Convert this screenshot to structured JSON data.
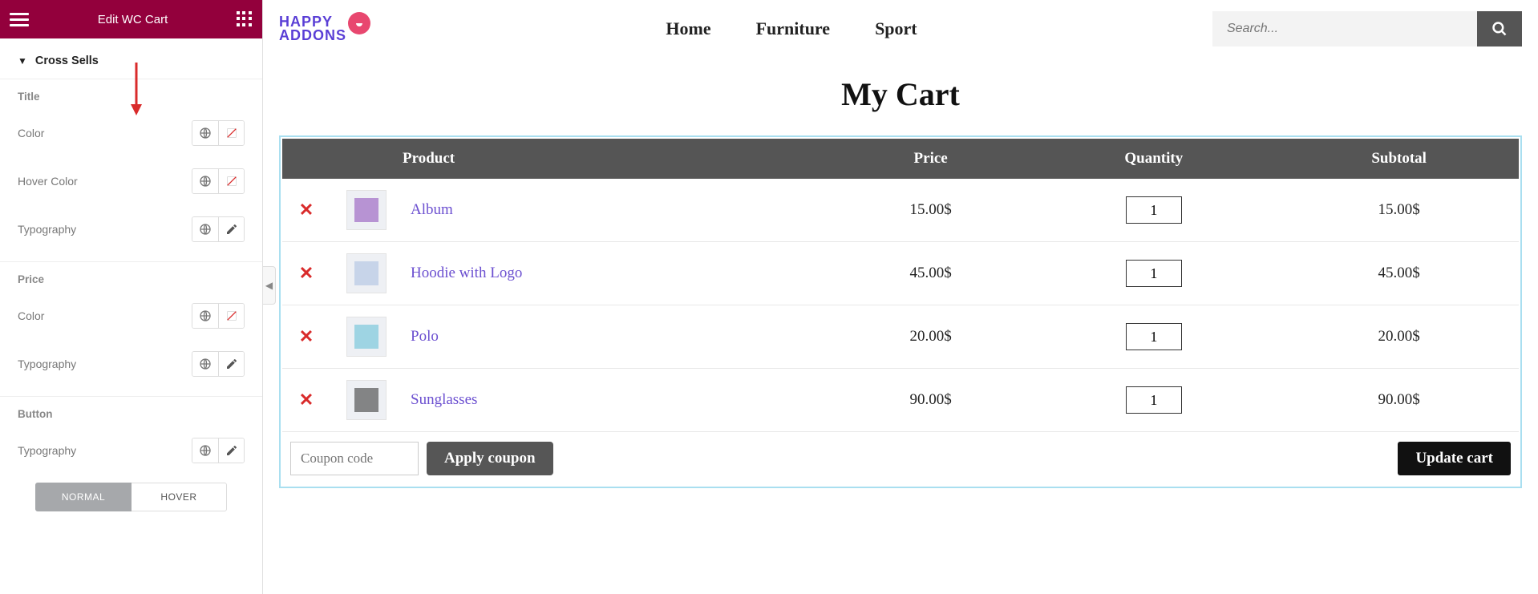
{
  "sidebar": {
    "header_title": "Edit WC Cart",
    "section_label": "Cross Sells",
    "groups": [
      {
        "title": "Title",
        "controls": [
          {
            "label": "Color",
            "type": "color"
          },
          {
            "label": "Hover Color",
            "type": "color"
          },
          {
            "label": "Typography",
            "type": "typography"
          }
        ]
      },
      {
        "title": "Price",
        "controls": [
          {
            "label": "Color",
            "type": "color"
          },
          {
            "label": "Typography",
            "type": "typography"
          }
        ]
      },
      {
        "title": "Button",
        "controls": [
          {
            "label": "Typography",
            "type": "typography"
          }
        ]
      }
    ],
    "state_tabs": {
      "normal": "NORMAL",
      "hover": "HOVER"
    }
  },
  "main": {
    "logo": {
      "line1": "HAPPY",
      "line2": "ADDONS"
    },
    "nav": [
      "Home",
      "Furniture",
      "Sport"
    ],
    "search_placeholder": "Search...",
    "page_title": "My Cart",
    "table": {
      "headers": {
        "product": "Product",
        "price": "Price",
        "quantity": "Quantity",
        "subtotal": "Subtotal"
      },
      "rows": [
        {
          "name": "Album",
          "price": "15.00$",
          "qty": "1",
          "subtotal": "15.00$",
          "thumb_color": "#a06bc4"
        },
        {
          "name": "Hoodie with Logo",
          "price": "45.00$",
          "qty": "1",
          "subtotal": "45.00$",
          "thumb_color": "#b6c8e4"
        },
        {
          "name": "Polo",
          "price": "20.00$",
          "qty": "1",
          "subtotal": "20.00$",
          "thumb_color": "#7cc7db"
        },
        {
          "name": "Sunglasses",
          "price": "90.00$",
          "qty": "1",
          "subtotal": "90.00$",
          "thumb_color": "#555555"
        }
      ]
    },
    "coupon_placeholder": "Coupon code",
    "apply_coupon": "Apply coupon",
    "update_cart": "Update cart"
  }
}
